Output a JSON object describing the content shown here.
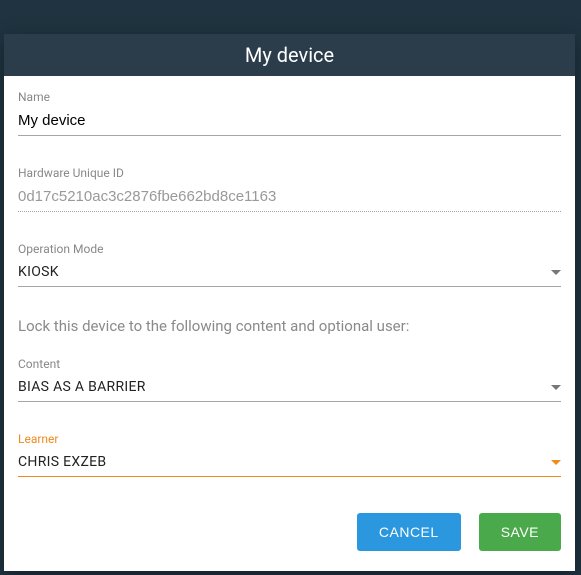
{
  "modal": {
    "title": "My device",
    "help_text": "Lock this device to the following content and optional user:",
    "fields": {
      "name": {
        "label": "Name",
        "value": "My device"
      },
      "hardware_id": {
        "label": "Hardware Unique ID",
        "value": "0d17c5210ac3c2876fbe662bd8ce1163"
      },
      "op_mode": {
        "label": "Operation Mode",
        "value": "KIOSK"
      },
      "content": {
        "label": "Content",
        "value": "BIAS AS A BARRIER"
      },
      "learner": {
        "label": "Learner",
        "value": "CHRIS EXZEB"
      }
    },
    "buttons": {
      "cancel": "CANCEL",
      "save": "SAVE"
    }
  }
}
